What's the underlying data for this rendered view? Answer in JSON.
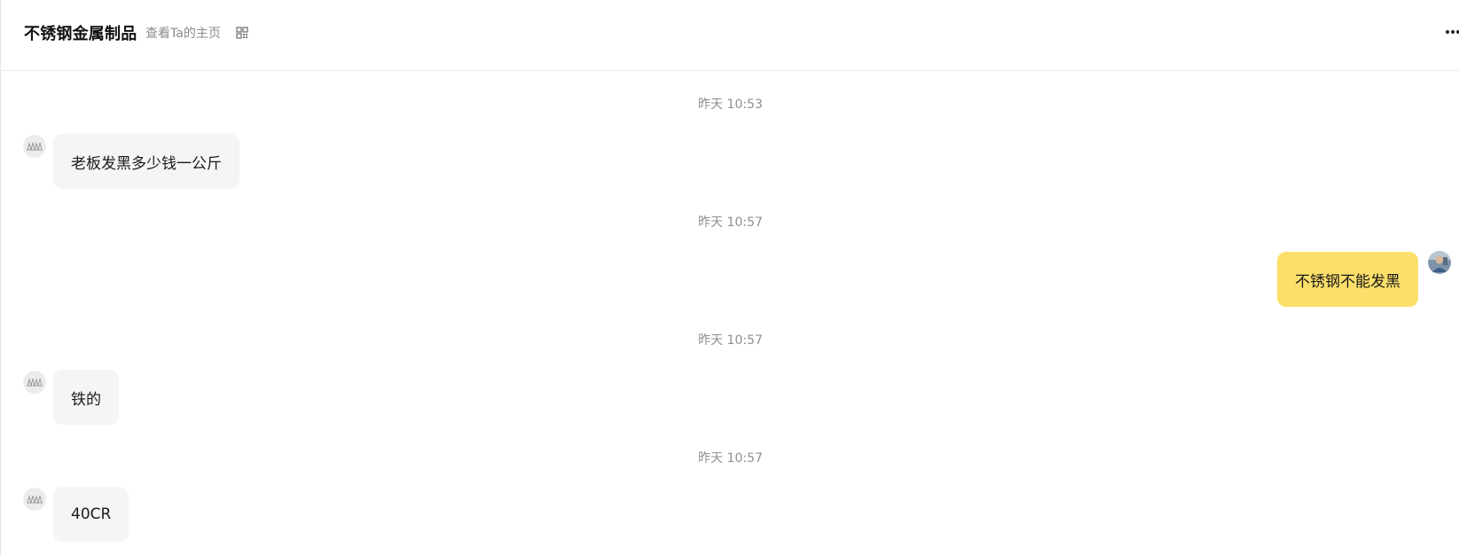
{
  "header": {
    "title": "不锈钢金属制品",
    "homepage_link": "查看Ta的主页",
    "qr_icon": "qr-code-icon",
    "more_icon": "more-horizontal-icon"
  },
  "messages": [
    {
      "time": "昨天 10:53",
      "direction": "incoming",
      "text": "老板发黑多少钱一公斤"
    },
    {
      "time": "昨天 10:57",
      "direction": "outgoing",
      "text": "不锈钢不能发黑"
    },
    {
      "time": "昨天 10:57",
      "direction": "incoming",
      "text": "铁的"
    },
    {
      "time": "昨天 10:57",
      "direction": "incoming",
      "text": "40CR"
    }
  ],
  "colors": {
    "incoming_bubble": "#f5f5f5",
    "outgoing_bubble": "#fbdf6a",
    "timestamp_text": "#8f8f8f",
    "secondary_text": "#8a8a8a"
  }
}
